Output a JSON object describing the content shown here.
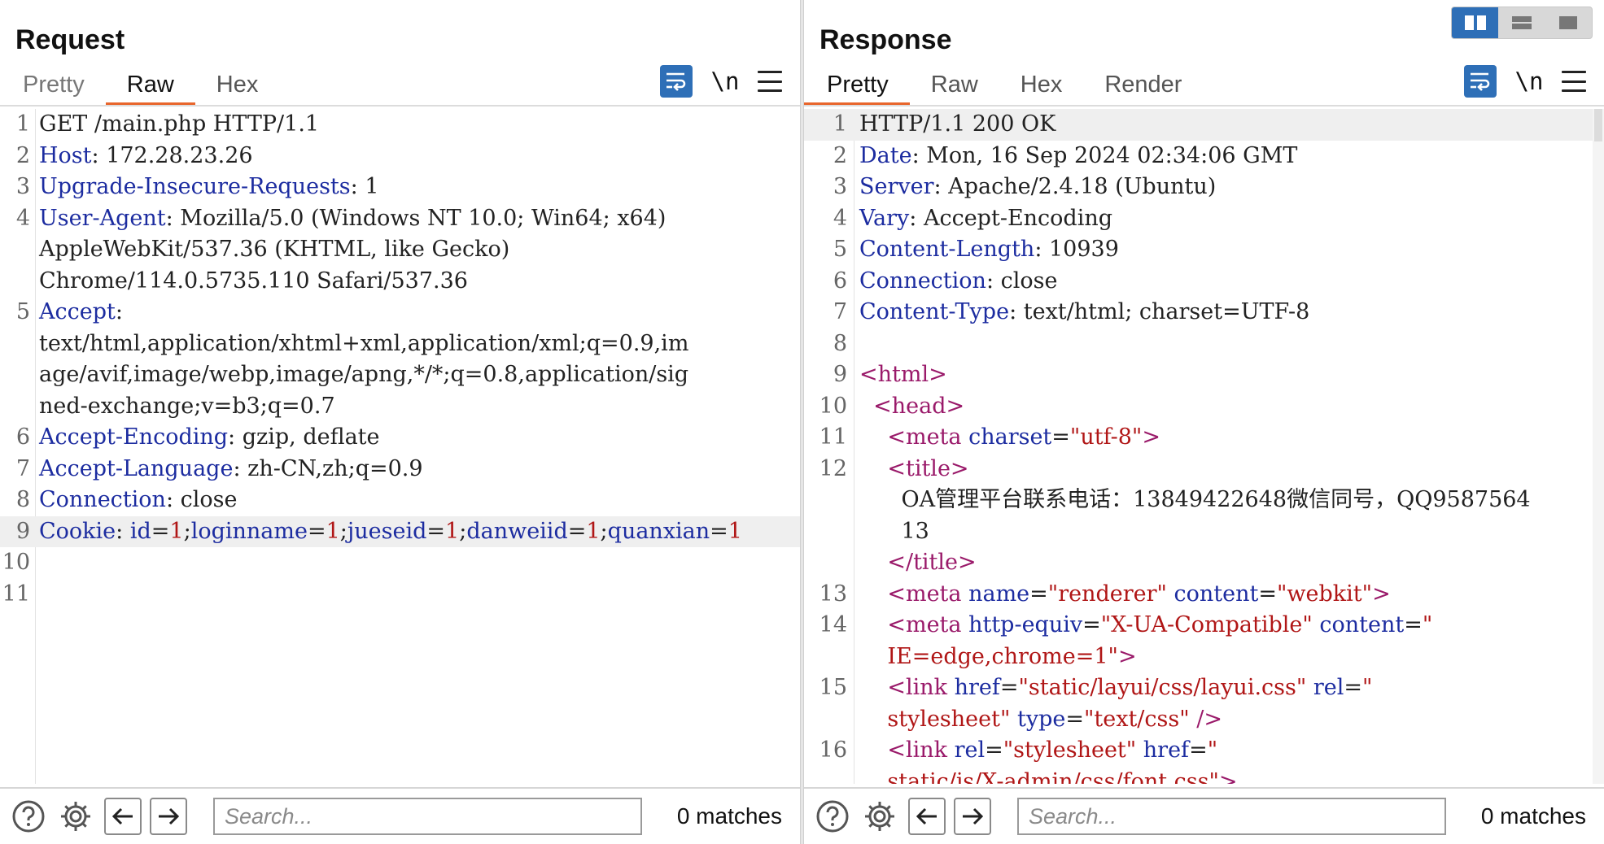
{
  "request": {
    "title": "Request",
    "tabs": [
      "Pretty",
      "Raw",
      "Hex"
    ],
    "active_tab": "Raw",
    "newline_toggle": "\\n",
    "lines": [
      {
        "n": "1",
        "parts": [
          {
            "c": "val",
            "t": "GET /main.php HTTP/1.1"
          }
        ]
      },
      {
        "n": "2",
        "parts": [
          {
            "c": "key",
            "t": "Host"
          },
          {
            "c": "val",
            "t": ": 172.28.23.26"
          }
        ]
      },
      {
        "n": "3",
        "parts": [
          {
            "c": "key",
            "t": "Upgrade-Insecure-Requests"
          },
          {
            "c": "val",
            "t": ": 1"
          }
        ]
      },
      {
        "n": "4",
        "parts": [
          {
            "c": "key",
            "t": "User-Agent"
          },
          {
            "c": "val",
            "t": ": Mozilla/5.0 (Windows NT 10.0; Win64; x64)"
          }
        ]
      },
      {
        "n": "",
        "parts": [
          {
            "c": "val",
            "t": "AppleWebKit/537.36 (KHTML, like Gecko)"
          }
        ]
      },
      {
        "n": "",
        "parts": [
          {
            "c": "val",
            "t": "Chrome/114.0.5735.110 Safari/537.36"
          }
        ]
      },
      {
        "n": "5",
        "parts": [
          {
            "c": "key",
            "t": "Accept"
          },
          {
            "c": "val",
            "t": ":"
          }
        ]
      },
      {
        "n": "",
        "parts": [
          {
            "c": "val",
            "t": "text/html,application/xhtml+xml,application/xml;q=0.9,im"
          }
        ]
      },
      {
        "n": "",
        "parts": [
          {
            "c": "val",
            "t": "age/avif,image/webp,image/apng,*/*;q=0.8,application/sig"
          }
        ]
      },
      {
        "n": "",
        "parts": [
          {
            "c": "val",
            "t": "ned-exchange;v=b3;q=0.7"
          }
        ]
      },
      {
        "n": "6",
        "parts": [
          {
            "c": "key",
            "t": "Accept-Encoding"
          },
          {
            "c": "val",
            "t": ": gzip, deflate"
          }
        ]
      },
      {
        "n": "7",
        "parts": [
          {
            "c": "key",
            "t": "Accept-Language"
          },
          {
            "c": "val",
            "t": ": zh-CN,zh;q=0.9"
          }
        ]
      },
      {
        "n": "8",
        "parts": [
          {
            "c": "key",
            "t": "Connection"
          },
          {
            "c": "val",
            "t": ": close"
          }
        ]
      },
      {
        "n": "9",
        "hl": true,
        "parts": [
          {
            "c": "key",
            "t": "Cookie"
          },
          {
            "c": "val",
            "t": ": "
          },
          {
            "c": "ck-name",
            "t": "id"
          },
          {
            "c": "val",
            "t": "="
          },
          {
            "c": "ck-val",
            "t": "1"
          },
          {
            "c": "val",
            "t": ";"
          },
          {
            "c": "ck-name",
            "t": "loginname"
          },
          {
            "c": "val",
            "t": "="
          },
          {
            "c": "ck-val",
            "t": "1"
          },
          {
            "c": "val",
            "t": ";"
          },
          {
            "c": "ck-name",
            "t": "jueseid"
          },
          {
            "c": "val",
            "t": "="
          },
          {
            "c": "ck-val",
            "t": "1"
          },
          {
            "c": "val",
            "t": ";"
          },
          {
            "c": "ck-name",
            "t": "danweiid"
          },
          {
            "c": "val",
            "t": "="
          },
          {
            "c": "ck-val",
            "t": "1"
          },
          {
            "c": "val",
            "t": ";"
          },
          {
            "c": "ck-name",
            "t": "quanxian"
          },
          {
            "c": "val",
            "t": "="
          },
          {
            "c": "ck-val",
            "t": "1"
          }
        ]
      },
      {
        "n": "10",
        "parts": []
      },
      {
        "n": "11",
        "parts": []
      }
    ],
    "search_placeholder": "Search...",
    "matches": "0 matches"
  },
  "response": {
    "title": "Response",
    "tabs": [
      "Pretty",
      "Raw",
      "Hex",
      "Render"
    ],
    "active_tab": "Pretty",
    "newline_toggle": "\\n",
    "lines": [
      {
        "n": "1",
        "hl": true,
        "parts": [
          {
            "c": "val",
            "t": "HTTP/1.1 200 OK"
          }
        ]
      },
      {
        "n": "2",
        "parts": [
          {
            "c": "key",
            "t": "Date"
          },
          {
            "c": "val",
            "t": ": Mon, 16 Sep 2024 02:34:06 GMT"
          }
        ]
      },
      {
        "n": "3",
        "parts": [
          {
            "c": "key",
            "t": "Server"
          },
          {
            "c": "val",
            "t": ": Apache/2.4.18 (Ubuntu)"
          }
        ]
      },
      {
        "n": "4",
        "parts": [
          {
            "c": "key",
            "t": "Vary"
          },
          {
            "c": "val",
            "t": ": Accept-Encoding"
          }
        ]
      },
      {
        "n": "5",
        "parts": [
          {
            "c": "key",
            "t": "Content-Length"
          },
          {
            "c": "val",
            "t": ": 10939"
          }
        ]
      },
      {
        "n": "6",
        "parts": [
          {
            "c": "key",
            "t": "Connection"
          },
          {
            "c": "val",
            "t": ": close"
          }
        ]
      },
      {
        "n": "7",
        "parts": [
          {
            "c": "key",
            "t": "Content-Type"
          },
          {
            "c": "val",
            "t": ": text/html; charset=UTF-8"
          }
        ]
      },
      {
        "n": "8",
        "parts": []
      },
      {
        "n": "9",
        "parts": [
          {
            "c": "tag",
            "t": "<html>"
          }
        ]
      },
      {
        "n": "10",
        "parts": [
          {
            "c": "txt",
            "t": "  "
          },
          {
            "c": "tag",
            "t": "<head>"
          }
        ]
      },
      {
        "n": "11",
        "parts": [
          {
            "c": "txt",
            "t": "    "
          },
          {
            "c": "tag",
            "t": "<meta"
          },
          {
            "c": "attr",
            "t": " charset"
          },
          {
            "c": "txt",
            "t": "="
          },
          {
            "c": "str",
            "t": "\"utf-8\""
          },
          {
            "c": "tag",
            "t": ">"
          }
        ]
      },
      {
        "n": "12",
        "parts": [
          {
            "c": "txt",
            "t": "    "
          },
          {
            "c": "tag",
            "t": "<title>"
          }
        ]
      },
      {
        "n": "",
        "parts": [
          {
            "c": "txt",
            "t": "      OA管理平台联系电话：13849422648微信同号，QQ9587564"
          }
        ]
      },
      {
        "n": "",
        "parts": [
          {
            "c": "txt",
            "t": "      13"
          }
        ]
      },
      {
        "n": "",
        "parts": [
          {
            "c": "txt",
            "t": "    "
          },
          {
            "c": "tag",
            "t": "</title>"
          }
        ]
      },
      {
        "n": "13",
        "parts": [
          {
            "c": "txt",
            "t": "    "
          },
          {
            "c": "tag",
            "t": "<meta"
          },
          {
            "c": "attr",
            "t": " name"
          },
          {
            "c": "txt",
            "t": "="
          },
          {
            "c": "str",
            "t": "\"renderer\""
          },
          {
            "c": "attr",
            "t": " content"
          },
          {
            "c": "txt",
            "t": "="
          },
          {
            "c": "str",
            "t": "\"webkit\""
          },
          {
            "c": "tag",
            "t": ">"
          }
        ]
      },
      {
        "n": "14",
        "parts": [
          {
            "c": "txt",
            "t": "    "
          },
          {
            "c": "tag",
            "t": "<meta"
          },
          {
            "c": "attr",
            "t": " http-equiv"
          },
          {
            "c": "txt",
            "t": "="
          },
          {
            "c": "str",
            "t": "\"X-UA-Compatible\""
          },
          {
            "c": "attr",
            "t": " content"
          },
          {
            "c": "txt",
            "t": "="
          },
          {
            "c": "str",
            "t": "\""
          }
        ]
      },
      {
        "n": "",
        "parts": [
          {
            "c": "txt",
            "t": "    "
          },
          {
            "c": "str",
            "t": "IE=edge,chrome=1\""
          },
          {
            "c": "tag",
            "t": ">"
          }
        ]
      },
      {
        "n": "15",
        "parts": [
          {
            "c": "txt",
            "t": "    "
          },
          {
            "c": "tag",
            "t": "<link"
          },
          {
            "c": "attr",
            "t": " href"
          },
          {
            "c": "txt",
            "t": "="
          },
          {
            "c": "str",
            "t": "\"static/layui/css/layui.css\""
          },
          {
            "c": "attr",
            "t": " rel"
          },
          {
            "c": "txt",
            "t": "="
          },
          {
            "c": "str",
            "t": "\""
          }
        ]
      },
      {
        "n": "",
        "parts": [
          {
            "c": "txt",
            "t": "    "
          },
          {
            "c": "str",
            "t": "stylesheet\""
          },
          {
            "c": "attr",
            "t": " type"
          },
          {
            "c": "txt",
            "t": "="
          },
          {
            "c": "str",
            "t": "\"text/css\""
          },
          {
            "c": "tag",
            "t": " />"
          }
        ]
      },
      {
        "n": "16",
        "parts": [
          {
            "c": "txt",
            "t": "    "
          },
          {
            "c": "tag",
            "t": "<link"
          },
          {
            "c": "attr",
            "t": " rel"
          },
          {
            "c": "txt",
            "t": "="
          },
          {
            "c": "str",
            "t": "\"stylesheet\""
          },
          {
            "c": "attr",
            "t": " href"
          },
          {
            "c": "txt",
            "t": "="
          },
          {
            "c": "str",
            "t": "\""
          }
        ]
      },
      {
        "n": "",
        "parts": [
          {
            "c": "txt",
            "t": "    "
          },
          {
            "c": "str",
            "t": "static/js/X-admin/css/font.css\""
          },
          {
            "c": "tag",
            "t": ">"
          }
        ]
      }
    ],
    "search_placeholder": "Search...",
    "matches": "0 matches"
  },
  "colors": {
    "accent": "#e8662c",
    "toolbar_blue": "#2e6fb7",
    "header_key": "#1c2ca0",
    "string": "#b01616",
    "tag": "#9a1a6a"
  },
  "icons": {
    "wrap": "wrap-lines-icon",
    "menu": "hamburger-menu-icon",
    "help": "help-icon",
    "settings": "gear-icon",
    "back": "arrow-left-icon",
    "forward": "arrow-right-icon",
    "layout": [
      "layout-side-by-side-icon",
      "layout-stacked-icon",
      "layout-single-icon"
    ]
  }
}
